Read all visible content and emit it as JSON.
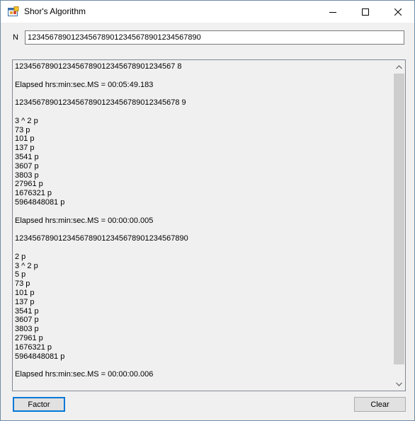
{
  "window": {
    "title": "Shor's Algorithm",
    "icon": "app-window-icon"
  },
  "input": {
    "label": "N",
    "value": "1234567890123456789012345678901234567890"
  },
  "output": {
    "lines": [
      "1234567890123456789012345678901234567 8",
      "",
      "Elapsed hrs:min:sec.MS = 00:05:49.183",
      "",
      "12345678901234567890123456789012345678 9",
      "",
      "3 ^ 2 p",
      "73 p",
      "101 p",
      "137 p",
      "3541 p",
      "3607 p",
      "3803 p",
      "27961 p",
      "1676321 p",
      "5964848081 p",
      "",
      "Elapsed hrs:min:sec.MS = 00:00:00.005",
      "",
      "1234567890123456789012345678901234567890",
      "",
      "2 p",
      "3 ^ 2 p",
      "5 p",
      "73 p",
      "101 p",
      "137 p",
      "3541 p",
      "3607 p",
      "3803 p",
      "27961 p",
      "1676321 p",
      "5964848081 p",
      "",
      "Elapsed hrs:min:sec.MS = 00:00:00.006"
    ]
  },
  "buttons": {
    "factor_label": "Factor",
    "clear_label": "Clear"
  },
  "colors": {
    "focus_border": "#0078d7",
    "window_bg": "#f0f0f0",
    "scroll_thumb": "#cdcdcd"
  }
}
